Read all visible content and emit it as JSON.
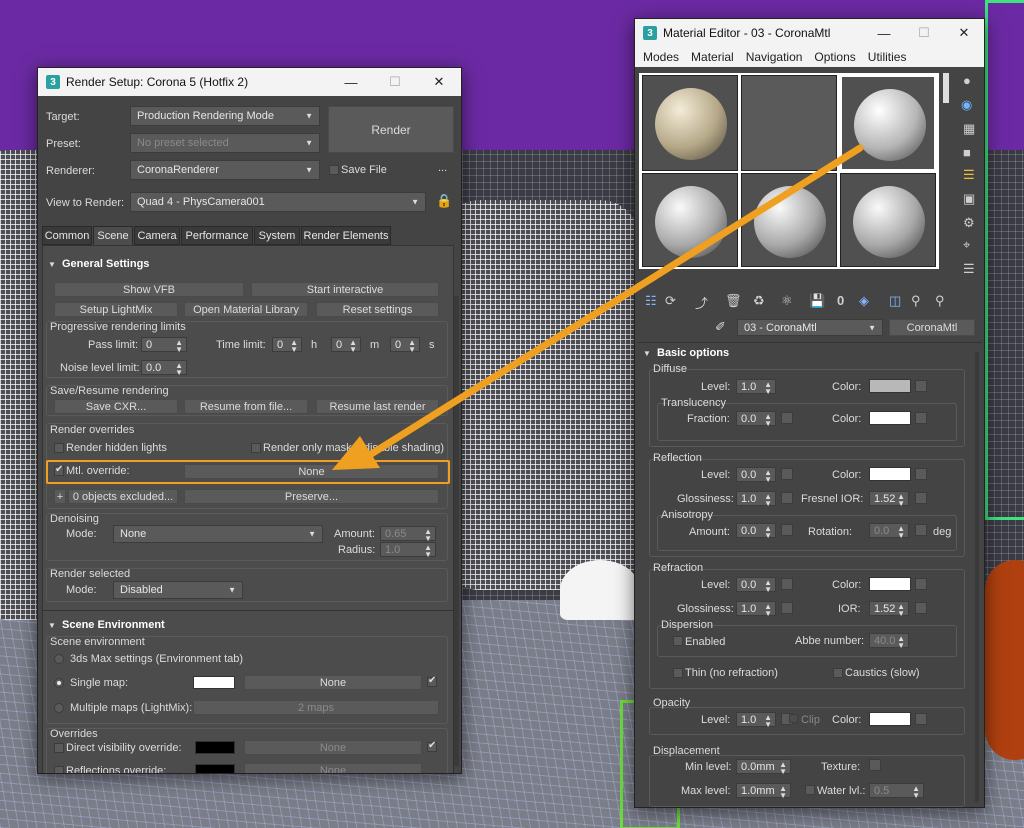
{
  "viewport": {
    "description": "3ds Max viewport with wireframe sofa"
  },
  "render_setup": {
    "title": "Render Setup: Corona 5 (Hotfix 2)",
    "target_label": "Target:",
    "target_value": "Production Rendering Mode",
    "preset_label": "Preset:",
    "preset_value": "No preset selected",
    "renderer_label": "Renderer:",
    "renderer_value": "CoronaRenderer",
    "render_button": "Render",
    "save_file": "Save File",
    "more": "...",
    "view_label": "View to Render:",
    "view_value": "Quad 4 - PhysCamera001",
    "tabs": [
      "Common",
      "Scene",
      "Camera",
      "Performance",
      "System",
      "Render Elements"
    ],
    "general_settings": "General Settings",
    "show_vfb": "Show VFB",
    "start_interactive": "Start interactive",
    "setup_lightmix": "Setup LightMix",
    "open_material_library": "Open Material Library",
    "reset_settings": "Reset settings",
    "progressive_limits": "Progressive rendering limits",
    "pass_limit_label": "Pass limit:",
    "pass_limit": "0",
    "time_limit_label": "Time limit:",
    "time_h": "0",
    "time_m": "0",
    "time_s": "0",
    "h": "h",
    "m": "m",
    "s": "s",
    "noise_label": "Noise level limit:",
    "noise_value": "0.0",
    "save_resume": "Save/Resume rendering",
    "save_cxr": "Save CXR...",
    "resume_file": "Resume from file...",
    "resume_last": "Resume last render",
    "render_overrides": "Render overrides",
    "render_hidden_lights": "Render hidden lights",
    "render_only_masks": "Render only masks (disable shading)",
    "mtl_override": "Mtl. override:",
    "mtl_override_value": "None",
    "objects_excluded": "0 objects excluded...",
    "preserve": "Preserve...",
    "plus": "+",
    "denoising": "Denoising",
    "mode_label": "Mode:",
    "denoise_mode": "None",
    "amount_label": "Amount:",
    "amount_value": "0.65",
    "radius_label": "Radius:",
    "radius_value": "1.0",
    "render_selected": "Render selected",
    "render_selected_mode": "Disabled",
    "scene_environment": "Scene Environment",
    "scene_env_group": "Scene environment",
    "env_3ds": "3ds Max settings (Environment tab)",
    "single_map": "Single map:",
    "single_map_value": "None",
    "multiple_maps": "Multiple maps (LightMix):",
    "multiple_maps_value": "2 maps",
    "overrides": "Overrides",
    "direct_visibility": "Direct visibility override:",
    "direct_visibility_value": "None",
    "reflections_override": "Reflections override:",
    "reflections_value": "None"
  },
  "material_editor": {
    "title": "Material Editor - 03 - CoronaMtl",
    "menu": [
      "Modes",
      "Material",
      "Navigation",
      "Options",
      "Utilities"
    ],
    "material_name": "03 - CoronaMtl",
    "material_type": "CoronaMtl",
    "basic_options": "Basic options",
    "diffuse": "Diffuse",
    "level_label": "Level:",
    "color_label": "Color:",
    "diffuse_level": "1.0",
    "translucency": "Translucency",
    "fraction_label": "Fraction:",
    "fraction_value": "0.0",
    "reflection": "Reflection",
    "reflection_level": "0.0",
    "glossiness_label": "Glossiness:",
    "refl_gloss": "1.0",
    "fresnel_label": "Fresnel IOR:",
    "fresnel_value": "1.52",
    "anisotropy": "Anisotropy",
    "aniso_amount_label": "Amount:",
    "aniso_amount": "0.0",
    "rotation_label": "Rotation:",
    "rotation_value": "0.0",
    "deg": "deg",
    "refraction": "Refraction",
    "refraction_level": "0.0",
    "refr_gloss": "1.0",
    "ior_label": "IOR:",
    "ior_value": "1.52",
    "dispersion": "Dispersion",
    "enabled": "Enabled",
    "abbe_label": "Abbe number:",
    "abbe_value": "40.0",
    "thin": "Thin (no refraction)",
    "caustics": "Caustics (slow)",
    "opacity": "Opacity",
    "opacity_level": "1.0",
    "clip": "Clip",
    "displacement": "Displacement",
    "min_level_label": "Min level:",
    "min_level": "0.0mm",
    "texture_label": "Texture:",
    "max_level_label": "Max level:",
    "max_level": "1.0mm",
    "water_label": "Water lvl.:",
    "water_value": "0.5"
  },
  "colors": {
    "accent_orange": "#f0a020",
    "panel_bg": "#444444",
    "diffuse_color": "#b8b8b8"
  }
}
